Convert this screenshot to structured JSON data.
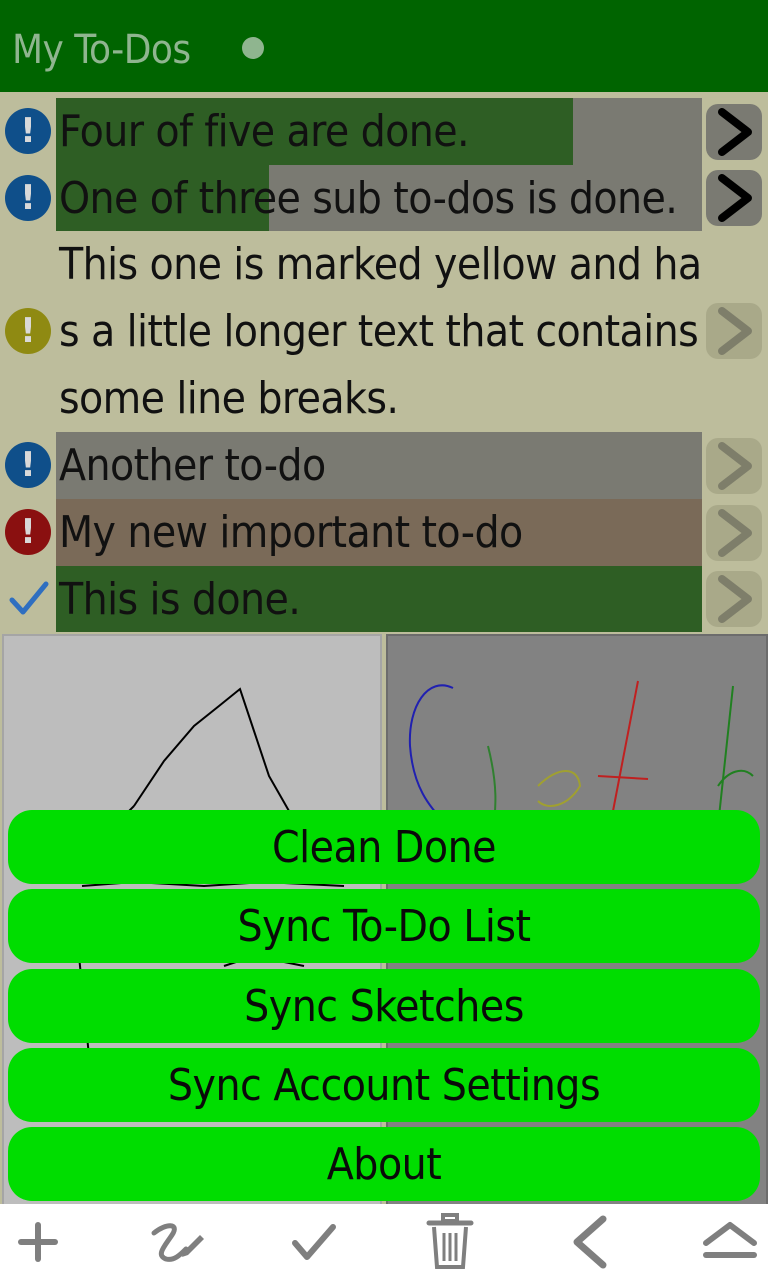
{
  "header": {
    "title": "My To-Dos"
  },
  "todos": [
    {
      "text": "Four of five are done.",
      "status": "info",
      "progress": 0.8,
      "bg": "#7a7a72"
    },
    {
      "text": "One of three sub to-dos is done.",
      "status": "info",
      "progress": 0.33,
      "bg": "#7a7a72"
    },
    {
      "text": "This one is marked yellow and has a little longer text that contains some line breaks.",
      "status": "warning",
      "progress": 0,
      "bg": "#bdbd9c"
    },
    {
      "text": "Another to-do",
      "status": "info",
      "progress": 0,
      "bg": "#7a7a72"
    },
    {
      "text": "My new important to-do",
      "status": "important",
      "progress": 0,
      "bg": "#7a6a58"
    },
    {
      "text": "This is done.",
      "status": "done",
      "progress": 1,
      "bg": "#2e5e24"
    }
  ],
  "menu": {
    "items": [
      {
        "label": "Clean Done"
      },
      {
        "label": "Sync To-Do List"
      },
      {
        "label": "Sync Sketches"
      },
      {
        "label": "Sync Account Settings"
      },
      {
        "label": "About"
      }
    ]
  },
  "bottombar": {
    "icons": [
      "add-icon",
      "sketch-pen-icon",
      "check-icon",
      "trash-icon",
      "back-icon",
      "eject-icon"
    ]
  },
  "colors": {
    "header_bg": "#006400",
    "menu_button": "#00dd00",
    "progress_green": "#2e5e24",
    "info_blue": "#0f4f8a",
    "warning_yellow": "#8f8a12",
    "important_red": "#8a1010",
    "done_check": "#2f6fc0"
  }
}
